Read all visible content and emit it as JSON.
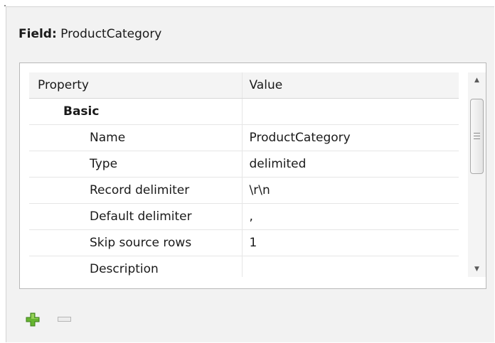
{
  "field": {
    "label": "Field:",
    "name": "ProductCategory"
  },
  "table": {
    "columns": [
      "Property",
      "Value"
    ],
    "group": "Basic",
    "rows": [
      {
        "property": "Name",
        "value": "ProductCategory"
      },
      {
        "property": "Type",
        "value": "delimited"
      },
      {
        "property": "Record delimiter",
        "value": "\\r\\n"
      },
      {
        "property": "Default delimiter",
        "value": ","
      },
      {
        "property": "Skip source rows",
        "value": "1"
      },
      {
        "property": "Description",
        "value": ""
      }
    ]
  },
  "scrollbar": {
    "up_icon": "scroll-up-arrow-icon",
    "down_icon": "scroll-down-arrow-icon"
  },
  "toolbar": {
    "add_icon": "plus-icon",
    "remove_icon": "minus-icon",
    "add_color": "#5fae2e",
    "remove_color": "#cfcfcf"
  }
}
